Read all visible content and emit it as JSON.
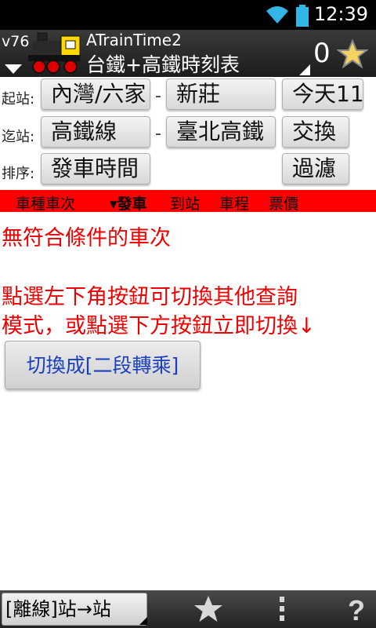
{
  "status_bar": {
    "time": "12:39"
  },
  "header": {
    "version": "v76",
    "app_name": "ATrainTime2",
    "app_subtitle": "台鐵+高鐵時刻表",
    "favorite_count": "0"
  },
  "from_row": {
    "label": "起站:",
    "area": "內灣/六家",
    "station": "新莊",
    "date": "今天11"
  },
  "to_row": {
    "label": "迄站:",
    "area": "高鐵線",
    "station": "臺北高鐵",
    "swap_label": "交換"
  },
  "sort_row": {
    "label": "排序:",
    "sort_value": "發車時間",
    "filter_label": "過濾"
  },
  "columns": {
    "train": "車種車次",
    "depart": "▾發車",
    "arrive": "到站",
    "duration": "車程",
    "fare": "票價"
  },
  "messages": {
    "no_result": "無符合條件的車次",
    "hint_line1": "點選左下角按鈕可切換其他查詢",
    "hint_line2": "模式，或點選下方按鈕立即切換↓"
  },
  "switch_button_label": "切換成[二段轉乘]",
  "bottom_bar": {
    "mode_label": "[離線]站→站"
  },
  "colors": {
    "accent_red": "#ff0000",
    "message_red": "#ee0000",
    "link_blue": "#1a3fbf"
  }
}
